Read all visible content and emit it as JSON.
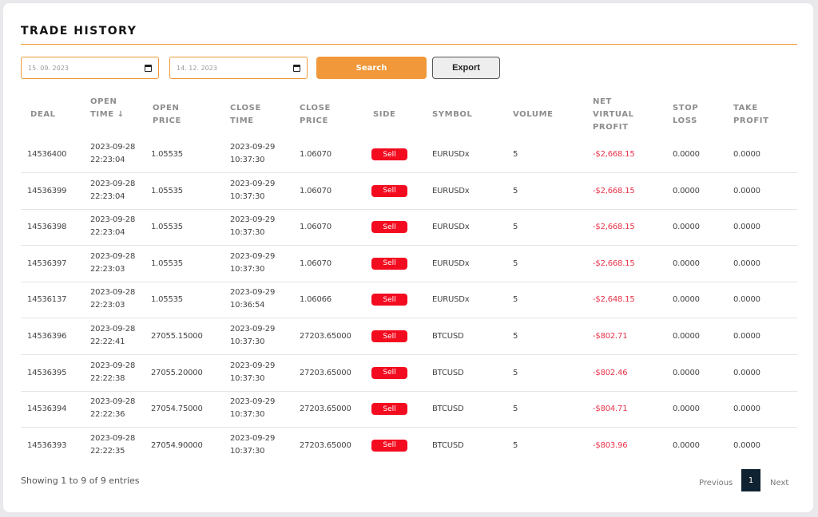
{
  "page": {
    "title": "TRADE HISTORY"
  },
  "filters": {
    "start_date": "15. 09. 2023",
    "end_date": "14. 12. 2023",
    "search_label": "Search",
    "export_label": "Export"
  },
  "table": {
    "columns": [
      {
        "key": "deal",
        "label": "DEAL"
      },
      {
        "key": "open_time",
        "label": "OPEN TIME ↓"
      },
      {
        "key": "open_price",
        "label": "OPEN PRICE"
      },
      {
        "key": "close_time",
        "label": "CLOSE TIME"
      },
      {
        "key": "close_price",
        "label": "CLOSE PRICE"
      },
      {
        "key": "side",
        "label": "SIDE"
      },
      {
        "key": "symbol",
        "label": "SYMBOL"
      },
      {
        "key": "volume",
        "label": "VOLUME"
      },
      {
        "key": "net_virtual_profit",
        "label": "NET VIRTUAL PROFIT"
      },
      {
        "key": "stop_loss",
        "label": "STOP LOSS"
      },
      {
        "key": "take_profit",
        "label": "TAKE PROFIT"
      }
    ],
    "rows": [
      {
        "deal": "14536400",
        "open_date": "2023-09-28",
        "open_clock": "22:23:04",
        "open_price": "1.05535",
        "close_date": "2023-09-29",
        "close_clock": "10:37:30",
        "close_price": "1.06070",
        "side": "Sell",
        "symbol": "EURUSDx",
        "volume": "5",
        "net_virtual_profit": "-$2,668.15",
        "stop_loss": "0.0000",
        "take_profit": "0.0000"
      },
      {
        "deal": "14536399",
        "open_date": "2023-09-28",
        "open_clock": "22:23:04",
        "open_price": "1.05535",
        "close_date": "2023-09-29",
        "close_clock": "10:37:30",
        "close_price": "1.06070",
        "side": "Sell",
        "symbol": "EURUSDx",
        "volume": "5",
        "net_virtual_profit": "-$2,668.15",
        "stop_loss": "0.0000",
        "take_profit": "0.0000"
      },
      {
        "deal": "14536398",
        "open_date": "2023-09-28",
        "open_clock": "22:23:04",
        "open_price": "1.05535",
        "close_date": "2023-09-29",
        "close_clock": "10:37:30",
        "close_price": "1.06070",
        "side": "Sell",
        "symbol": "EURUSDx",
        "volume": "5",
        "net_virtual_profit": "-$2,668.15",
        "stop_loss": "0.0000",
        "take_profit": "0.0000"
      },
      {
        "deal": "14536397",
        "open_date": "2023-09-28",
        "open_clock": "22:23:03",
        "open_price": "1.05535",
        "close_date": "2023-09-29",
        "close_clock": "10:37:30",
        "close_price": "1.06070",
        "side": "Sell",
        "symbol": "EURUSDx",
        "volume": "5",
        "net_virtual_profit": "-$2,668.15",
        "stop_loss": "0.0000",
        "take_profit": "0.0000"
      },
      {
        "deal": "14536137",
        "open_date": "2023-09-28",
        "open_clock": "22:23:03",
        "open_price": "1.05535",
        "close_date": "2023-09-29",
        "close_clock": "10:36:54",
        "close_price": "1.06066",
        "side": "Sell",
        "symbol": "EURUSDx",
        "volume": "5",
        "net_virtual_profit": "-$2,648.15",
        "stop_loss": "0.0000",
        "take_profit": "0.0000"
      },
      {
        "deal": "14536396",
        "open_date": "2023-09-28",
        "open_clock": "22:22:41",
        "open_price": "27055.15000",
        "close_date": "2023-09-29",
        "close_clock": "10:37:30",
        "close_price": "27203.65000",
        "side": "Sell",
        "symbol": "BTCUSD",
        "volume": "5",
        "net_virtual_profit": "-$802.71",
        "stop_loss": "0.0000",
        "take_profit": "0.0000"
      },
      {
        "deal": "14536395",
        "open_date": "2023-09-28",
        "open_clock": "22:22:38",
        "open_price": "27055.20000",
        "close_date": "2023-09-29",
        "close_clock": "10:37:30",
        "close_price": "27203.65000",
        "side": "Sell",
        "symbol": "BTCUSD",
        "volume": "5",
        "net_virtual_profit": "-$802.46",
        "stop_loss": "0.0000",
        "take_profit": "0.0000"
      },
      {
        "deal": "14536394",
        "open_date": "2023-09-28",
        "open_clock": "22:22:36",
        "open_price": "27054.75000",
        "close_date": "2023-09-29",
        "close_clock": "10:37:30",
        "close_price": "27203.65000",
        "side": "Sell",
        "symbol": "BTCUSD",
        "volume": "5",
        "net_virtual_profit": "-$804.71",
        "stop_loss": "0.0000",
        "take_profit": "0.0000"
      },
      {
        "deal": "14536393",
        "open_date": "2023-09-28",
        "open_clock": "22:22:35",
        "open_price": "27054.90000",
        "close_date": "2023-09-29",
        "close_clock": "10:37:30",
        "close_price": "27203.65000",
        "side": "Sell",
        "symbol": "BTCUSD",
        "volume": "5",
        "net_virtual_profit": "-$803.96",
        "stop_loss": "0.0000",
        "take_profit": "0.0000"
      }
    ]
  },
  "footer": {
    "entries_text": "Showing 1 to 9 of 9 entries",
    "previous_label": "Previous",
    "current_page": "1",
    "next_label": "Next"
  },
  "colors": {
    "accent": "#f0983a",
    "sell_badge": "#f30b1f",
    "negative_profit": "#e8334a",
    "active_page": "#0e2232"
  },
  "icons": {
    "date_picker": "calendar-icon",
    "sort": "arrow-down-icon"
  }
}
